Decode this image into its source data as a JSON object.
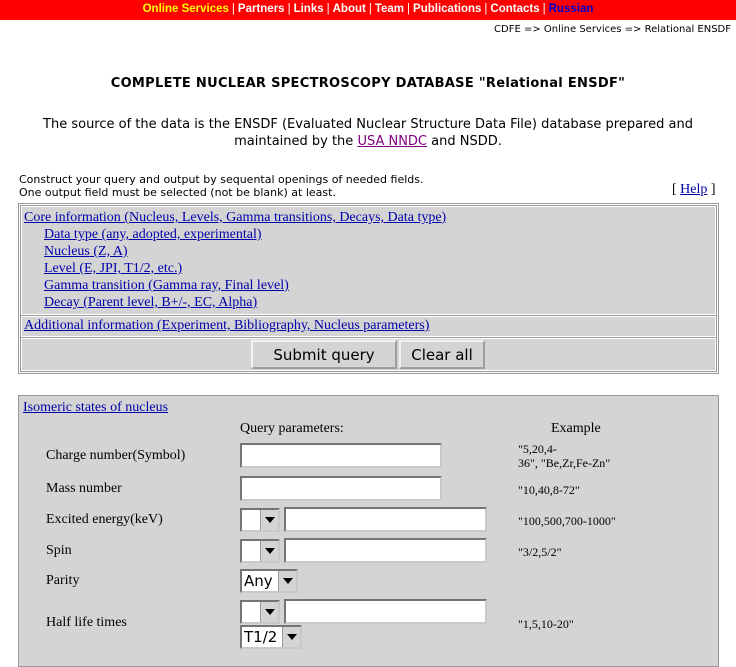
{
  "nav": {
    "items": [
      {
        "label": "Online Services"
      },
      {
        "label": "Partners"
      },
      {
        "label": "Links"
      },
      {
        "label": "About"
      },
      {
        "label": "Team"
      },
      {
        "label": "Publications"
      },
      {
        "label": "Contacts"
      },
      {
        "label": "Russian"
      }
    ],
    "separator": "|"
  },
  "breadcrumb": "CDFE => Online Services => Relational ENSDF",
  "title": "COMPLETE NUCLEAR SPECTROSCOPY DATABASE \"Relational ENSDF\"",
  "intro": {
    "line1": "The source of the data is the ENSDF (Evaluated Nuclear Structure Data File) database prepared and",
    "line2_prefix": "maintained by the ",
    "link": "USA NNDC",
    "line2_suffix": " and NSDD."
  },
  "instructions": {
    "line1": "Construct your query and output by sequental openings of needed fields.",
    "line2": "One output field must be selected (not be blank) at least."
  },
  "help": {
    "open": "[",
    "label": "Help",
    "close": "]"
  },
  "query": {
    "core_link": "Core information (Nucleus, Levels, Gamma transitions, Decays, Data type)",
    "sub_links": [
      "Data type (any, adopted, experimental)",
      "Nucleus (Z, A)",
      "Level (E, JPI, T1/2, etc.)",
      "Gamma transition (Gamma ray, Final level)",
      "Decay (Parent level, B+/-, EC, Alpha)"
    ],
    "additional_link": "Additional information (Experiment, Bibliography, Nucleus parameters)",
    "submit_label": "Submit query",
    "clear_label": "Clear all"
  },
  "isomeric": {
    "link": "Isomeric states of nucleus",
    "params_header": "Query parameters:",
    "example_header": "Example",
    "fields": {
      "charge": {
        "label": "Charge number(Symbol)",
        "example_line1": "\"5,20,4-",
        "example_line2": "36\", \"Be,Zr,Fe-Zn\""
      },
      "mass": {
        "label": "Mass number",
        "example": "\"10,40,8-72\""
      },
      "energy": {
        "label": "Excited energy(keV)",
        "example": "\"100,500,700-1000\""
      },
      "spin": {
        "label": "Spin",
        "example": "\"3/2,5/2\""
      },
      "parity": {
        "label": "Parity",
        "selected": "Any"
      },
      "halflife": {
        "label": "Half life times",
        "example": "\"1,5,10-20\"",
        "unit_selected": "T1/2"
      }
    }
  }
}
